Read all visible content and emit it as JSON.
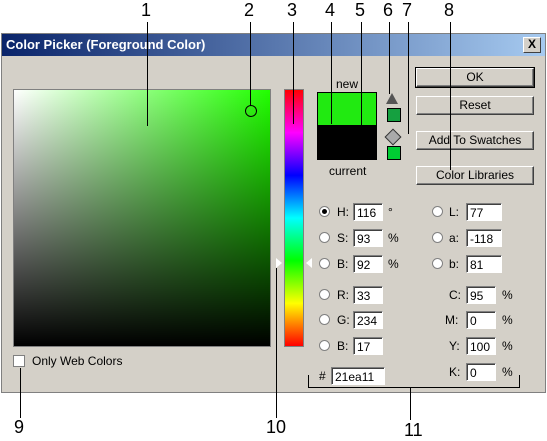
{
  "callouts": [
    "1",
    "2",
    "3",
    "4",
    "5",
    "6",
    "7",
    "8",
    "9",
    "10",
    "11"
  ],
  "dialog": {
    "title": "Color Picker (Foreground Color)",
    "close_label": "X"
  },
  "buttons": {
    "ok": "OK",
    "reset": "Reset",
    "add_to_swatches": "Add To Swatches",
    "color_libraries": "Color Libraries"
  },
  "preview": {
    "new_label": "new",
    "current_label": "current",
    "new_color": "#21ea11",
    "current_color": "#000000"
  },
  "only_web_colors": "Only Web Colors",
  "hsb": [
    {
      "label": "H:",
      "value": "116",
      "unit": "°",
      "selected": true
    },
    {
      "label": "S:",
      "value": "93",
      "unit": "%",
      "selected": false
    },
    {
      "label": "B:",
      "value": "92",
      "unit": "%",
      "selected": false
    }
  ],
  "rgb": [
    {
      "label": "R:",
      "value": "33"
    },
    {
      "label": "G:",
      "value": "234"
    },
    {
      "label": "B:",
      "value": "17"
    }
  ],
  "lab": [
    {
      "label": "L:",
      "value": "77"
    },
    {
      "label": "a:",
      "value": "-118"
    },
    {
      "label": "b:",
      "value": "81"
    }
  ],
  "cmyk": [
    {
      "label": "C:",
      "value": "95",
      "unit": "%"
    },
    {
      "label": "M:",
      "value": "0",
      "unit": "%"
    },
    {
      "label": "Y:",
      "value": "100",
      "unit": "%"
    },
    {
      "label": "K:",
      "value": "0",
      "unit": "%"
    }
  ],
  "hex": {
    "label": "#",
    "value": "21ea11"
  },
  "colors": {
    "gamut_warning": "#15a040",
    "web_safe": "#00cc33"
  }
}
